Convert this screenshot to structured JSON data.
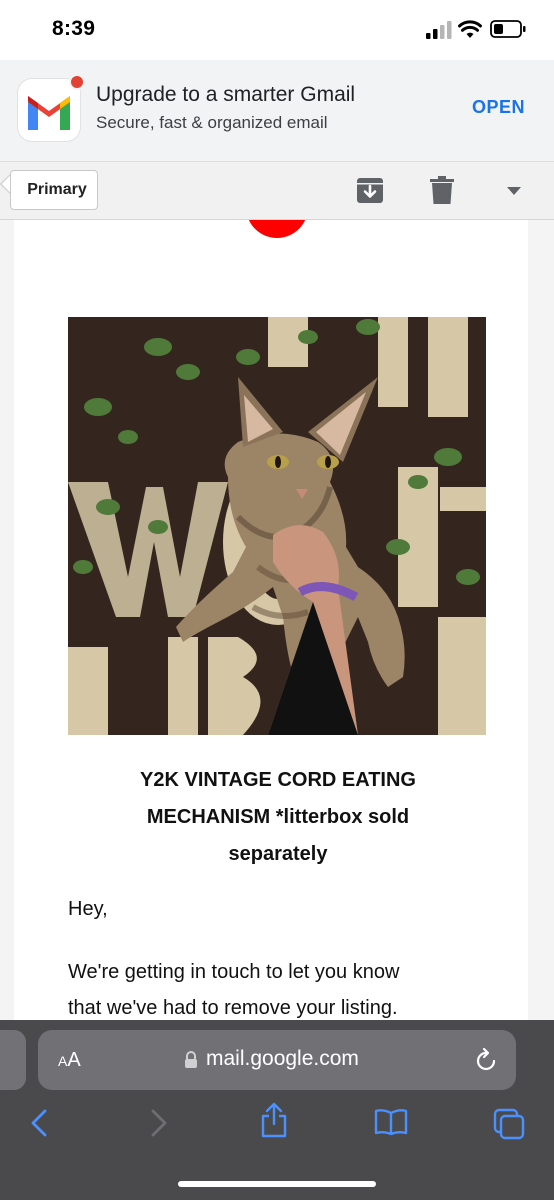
{
  "status_bar": {
    "time": "8:39"
  },
  "app_banner": {
    "title": "Upgrade to a smarter Gmail",
    "subtitle": "Secure, fast & organized email",
    "open_label": "OPEN"
  },
  "toolbar": {
    "primary_label": "Primary"
  },
  "email": {
    "heading_line1": "Y2K VINTAGE CORD EATING",
    "heading_line2": "MECHANISM *litterbox sold",
    "heading_line3": "separately",
    "greeting": "Hey,",
    "body_line1": "We're getting in touch to let you know",
    "body_line2": "that we've had to remove your listing."
  },
  "browser": {
    "aa_label": "AA",
    "url": "mail.google.com"
  },
  "colors": {
    "accent_blue": "#1a73e8",
    "safari_bar": "#4a4a4c",
    "brand_red": "#ff0000"
  },
  "icons": [
    "cellular-signal-icon",
    "wifi-icon",
    "battery-icon",
    "gmail-logo-icon",
    "archive-icon",
    "trash-icon",
    "dropdown-icon",
    "lock-icon",
    "reload-icon",
    "back-icon",
    "forward-icon",
    "share-icon",
    "bookmarks-icon",
    "tabs-icon"
  ]
}
